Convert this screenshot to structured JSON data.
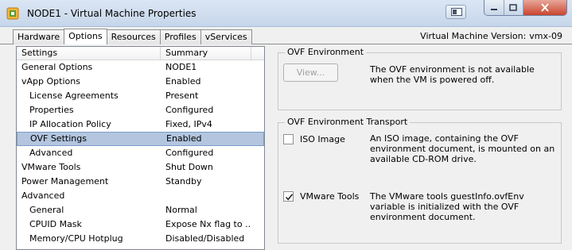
{
  "window": {
    "title": "NODE1 - Virtual Machine Properties",
    "vm_version_label": "Virtual Machine Version:",
    "vm_version_value": "vmx-09"
  },
  "tabs": [
    {
      "label": "Hardware",
      "active": false
    },
    {
      "label": "Options",
      "active": true
    },
    {
      "label": "Resources",
      "active": false
    },
    {
      "label": "Profiles",
      "active": false
    },
    {
      "label": "vServices",
      "active": false
    }
  ],
  "settings_list": {
    "headers": {
      "settings": "Settings",
      "summary": "Summary"
    },
    "rows": [
      {
        "setting": "General Options",
        "summary": "NODE1"
      },
      {
        "setting": "vApp Options",
        "summary": "Enabled"
      },
      {
        "setting": "License Agreements",
        "summary": "Present"
      },
      {
        "setting": "Properties",
        "summary": "Configured"
      },
      {
        "setting": "IP Allocation Policy",
        "summary": "Fixed, IPv4"
      },
      {
        "setting": "OVF Settings",
        "summary": "Enabled"
      },
      {
        "setting": "Advanced",
        "summary": "Configured"
      },
      {
        "setting": "VMware Tools",
        "summary": "Shut Down"
      },
      {
        "setting": "Power Management",
        "summary": "Standby"
      },
      {
        "setting": "Advanced",
        "summary": ""
      },
      {
        "setting": "General",
        "summary": "Normal"
      },
      {
        "setting": "CPUID Mask",
        "summary": "Expose Nx flag to ..."
      },
      {
        "setting": "Memory/CPU Hotplug",
        "summary": "Disabled/Disabled"
      }
    ]
  },
  "ovf_environment": {
    "title": "OVF Environment",
    "view_button": "View...",
    "message": "The OVF environment is not available when the VM is powered off."
  },
  "ovf_transport": {
    "title": "OVF Environment Transport",
    "iso": {
      "label": "ISO Image",
      "checked": false,
      "description": "An ISO image, containing the OVF environment document, is mounted on an available CD-ROM drive."
    },
    "vmware_tools": {
      "label": "VMware Tools",
      "checked": true,
      "description": "The VMware tools guestInfo.ovfEnv variable is initialized with the OVF environment document."
    }
  },
  "colors": {
    "selection": "#b3c5df",
    "titlebar": "#c6d6ea",
    "close_button": "#c9452f"
  },
  "icons": {
    "app": "vsphere-app-icon",
    "extra": "window-thumbnail-icon",
    "minimize": "minimize-icon",
    "maximize": "maximize-icon",
    "close": "close-icon"
  }
}
